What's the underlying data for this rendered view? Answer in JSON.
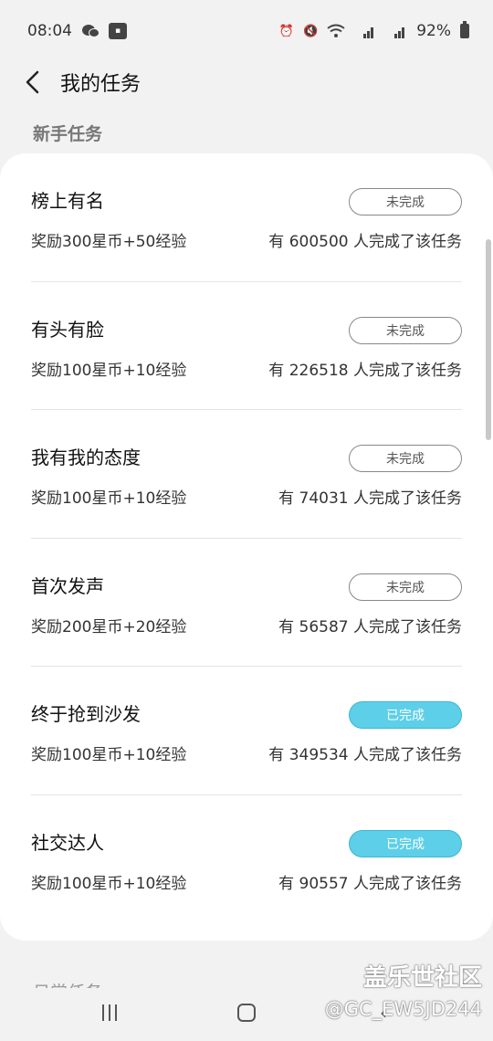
{
  "status_bar": {
    "time": "08:04",
    "battery_text": "92%",
    "icons": [
      "wechat-icon",
      "app-badge-icon",
      "alarm-icon",
      "mute-icon",
      "wifi-icon",
      "signal-4g-icon",
      "signal-4g-icon",
      "battery-icon"
    ]
  },
  "header": {
    "title": "我的任务"
  },
  "section": {
    "title": "新手任务",
    "next_title": "日常任务"
  },
  "colors": {
    "done": "#5dcfe8",
    "background": "#f2f2f2"
  },
  "tasks": [
    {
      "name": "榜上有名",
      "status": "未完成",
      "reward": "奖励300星币+50经验",
      "count": "有 600500 人完成了该任务",
      "done": false
    },
    {
      "name": "有头有脸",
      "status": "未完成",
      "reward": "奖励100星币+10经验",
      "count": "有 226518 人完成了该任务",
      "done": false
    },
    {
      "name": "我有我的态度",
      "status": "未完成",
      "reward": "奖励100星币+10经验",
      "count": "有 74031 人完成了该任务",
      "done": false
    },
    {
      "name": "首次发声",
      "status": "未完成",
      "reward": "奖励200星币+20经验",
      "count": "有 56587 人完成了该任务",
      "done": false
    },
    {
      "name": "终于抢到沙发",
      "status": "已完成",
      "reward": "奖励100星币+10经验",
      "count": "有 349534 人完成了该任务",
      "done": true
    },
    {
      "name": "社交达人",
      "status": "已完成",
      "reward": "奖励100星币+10经验",
      "count": "有 90557 人完成了该任务",
      "done": true
    }
  ],
  "watermark": {
    "brand": "盖乐世社区",
    "user": "@GC_EW5JD244"
  }
}
